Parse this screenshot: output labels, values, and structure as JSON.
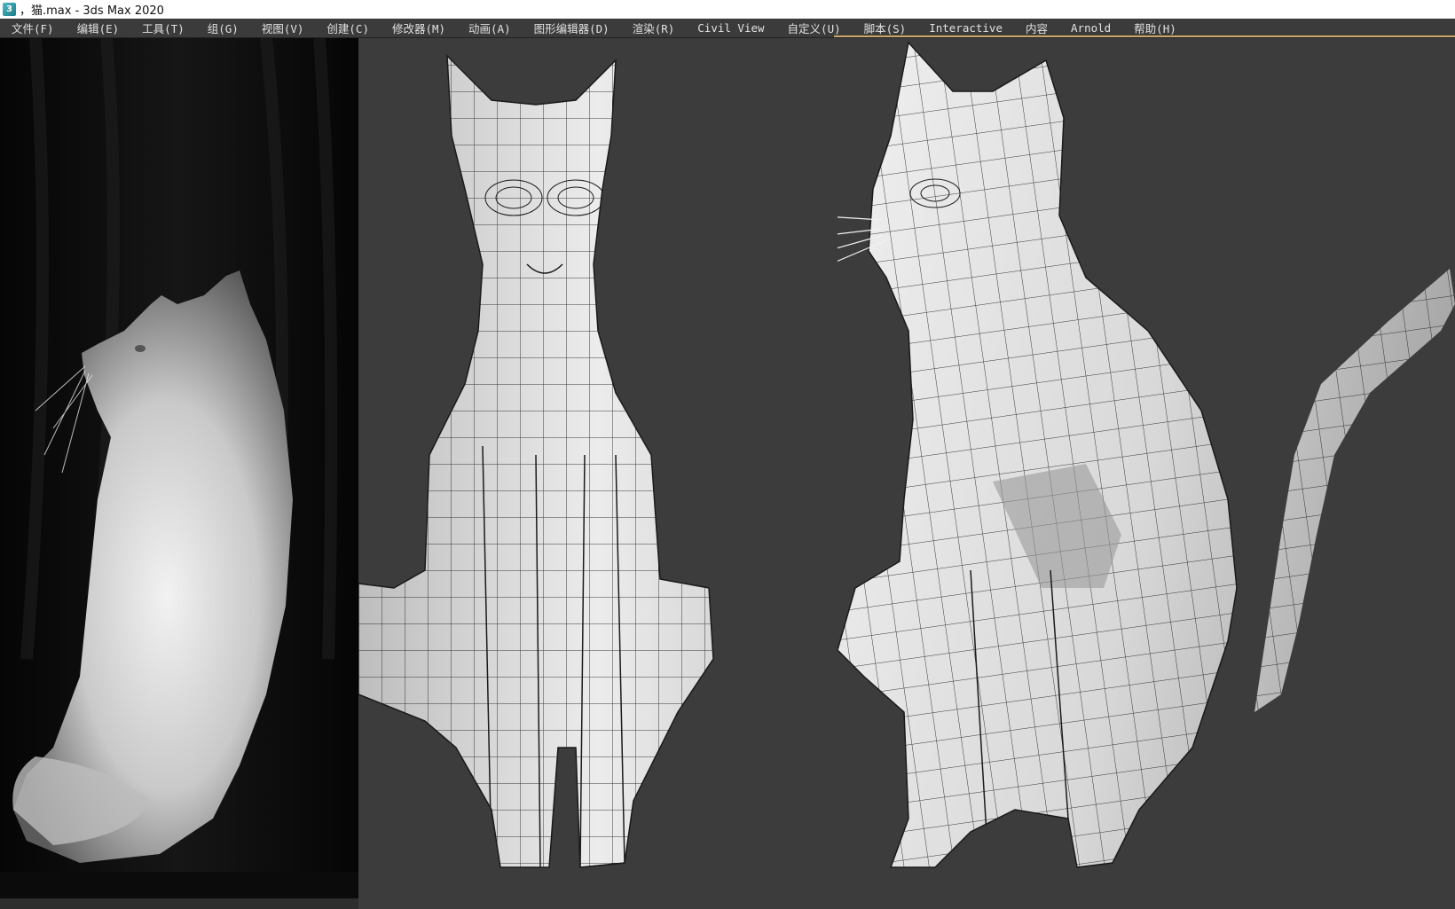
{
  "window": {
    "icon": "3ds-max-icon",
    "icon_glyph": "3",
    "title": "，猫.max - 3ds Max 2020"
  },
  "menu": [
    {
      "label": "文件(F)"
    },
    {
      "label": "编辑(E)"
    },
    {
      "label": "工具(T)"
    },
    {
      "label": "组(G)"
    },
    {
      "label": "视图(V)"
    },
    {
      "label": "创建(C)"
    },
    {
      "label": "修改器(M)"
    },
    {
      "label": "动画(A)"
    },
    {
      "label": "图形编辑器(D)"
    },
    {
      "label": "渲染(R)"
    },
    {
      "label": "Civil View"
    },
    {
      "label": "自定义(U)"
    },
    {
      "label": "脚本(S)"
    },
    {
      "label": "Interactive"
    },
    {
      "label": "内容"
    },
    {
      "label": "Arnold"
    },
    {
      "label": "帮助(H)"
    }
  ],
  "colors": {
    "viewport_bg": "#3c3c3c",
    "mesh_fill": "#dcdcdc",
    "mesh_wire": "#1a1a1a",
    "menu_accent": "#c9a96b"
  }
}
